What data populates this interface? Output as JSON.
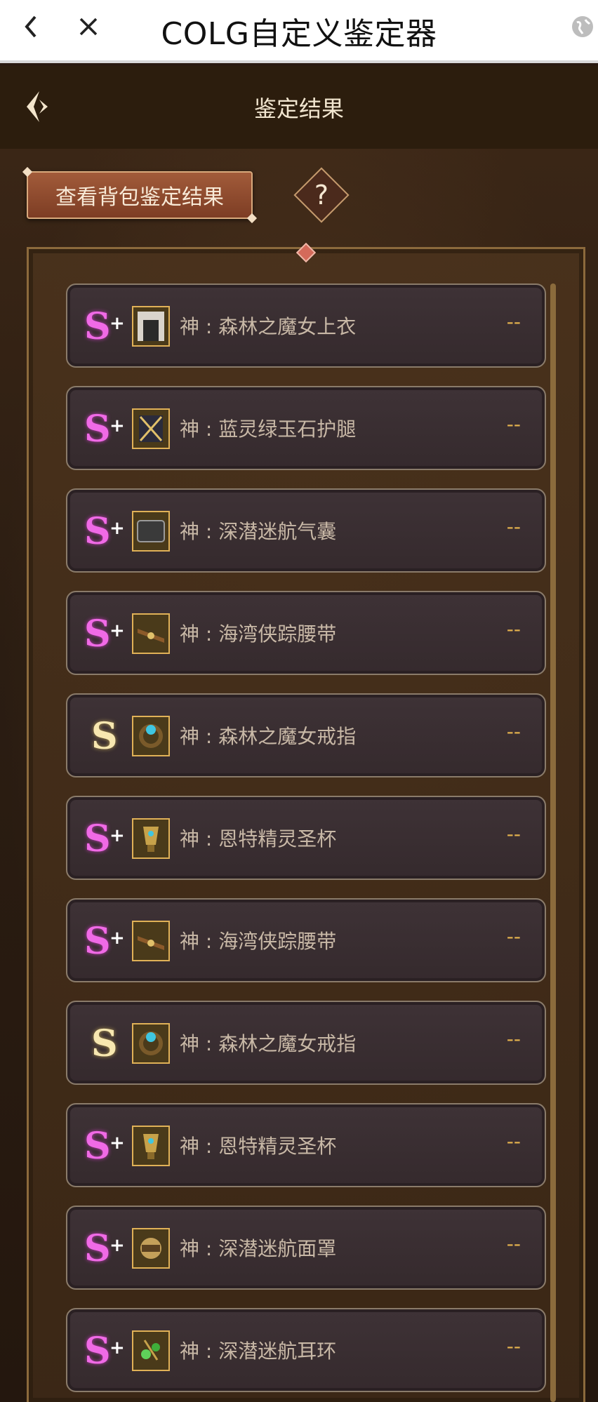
{
  "browser": {
    "title": "COLG自定义鉴定器"
  },
  "header": {
    "title": "鉴定结果"
  },
  "toolbar": {
    "bag_button_label": "查看背包鉴定结果",
    "help_label": "?"
  },
  "items": [
    {
      "grade": "S+",
      "name": "神 : 森林之魔女上衣",
      "value": "--"
    },
    {
      "grade": "S+",
      "name": "神 : 蓝灵绿玉石护腿",
      "value": "--"
    },
    {
      "grade": "S+",
      "name": "神 : 深潜迷航气囊",
      "value": "--"
    },
    {
      "grade": "S+",
      "name": "神 : 海湾侠踪腰带",
      "value": "--"
    },
    {
      "grade": "S",
      "name": "神 : 森林之魔女戒指",
      "value": "--"
    },
    {
      "grade": "S+",
      "name": "神 : 恩特精灵圣杯",
      "value": "--"
    },
    {
      "grade": "S+",
      "name": "神 : 海湾侠踪腰带",
      "value": "--"
    },
    {
      "grade": "S",
      "name": "神 : 森林之魔女戒指",
      "value": "--"
    },
    {
      "grade": "S+",
      "name": "神 : 恩特精灵圣杯",
      "value": "--"
    },
    {
      "grade": "S+",
      "name": "神 : 深潜迷航面罩",
      "value": "--"
    },
    {
      "grade": "S+",
      "name": "神 : 深潜迷航耳环",
      "value": "--"
    }
  ],
  "colors": {
    "accent_gold": "#e3b14d",
    "grade_splus": "#f06ae6",
    "grade_s": "#f7e7b0"
  }
}
